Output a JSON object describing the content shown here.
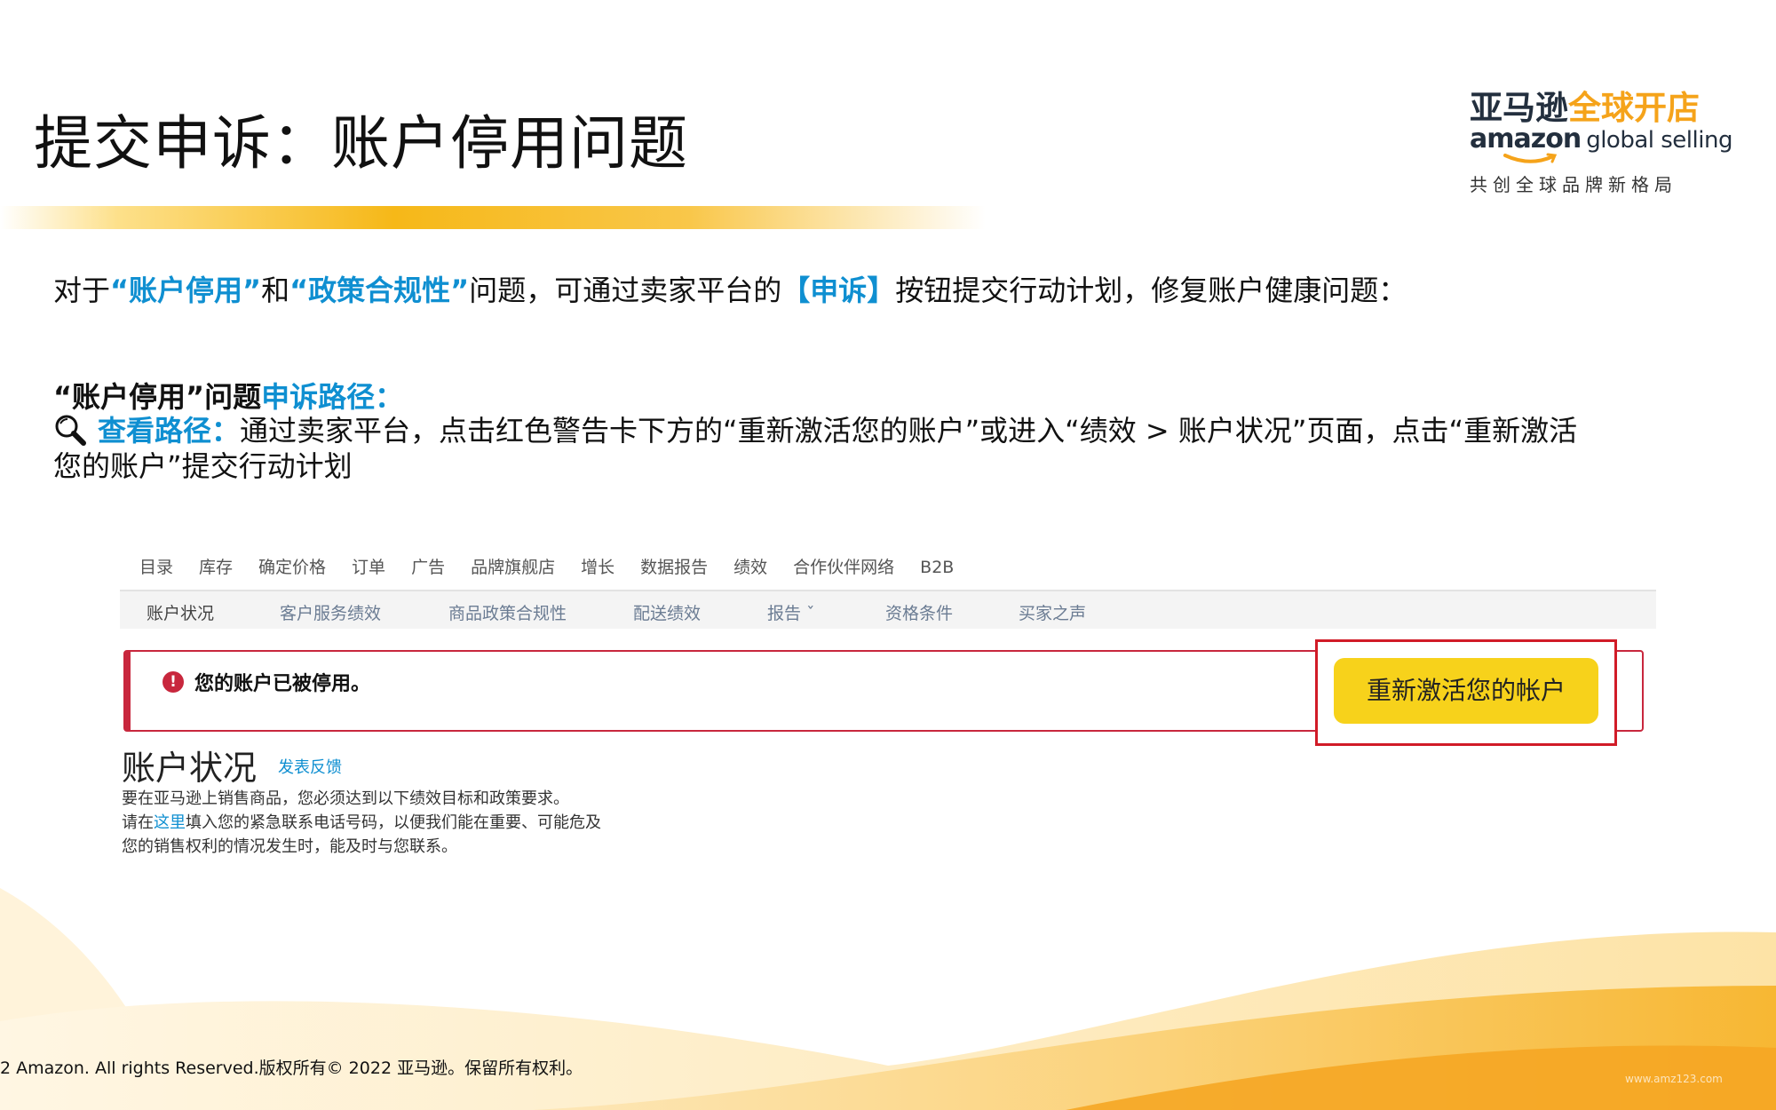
{
  "title": "提交申诉：账户停用问题",
  "logo": {
    "cn_part1": "亚马逊",
    "cn_part2": "全球开店",
    "en_brand": "amazon",
    "en_suffix": "global selling",
    "slogan": "共创全球品牌新格局"
  },
  "intro": {
    "p1": "对于",
    "hl1": "“账户停用”",
    "p2": "和",
    "hl2": "“政策合规性”",
    "p3": "问题，可通过卖家平台的",
    "hl3": "【申诉】",
    "p4": "按钮提交行动计划，修复账户健康问题："
  },
  "appeal_path": {
    "head_black": "“账户停用”问题",
    "head_blue": "申诉路径：",
    "view_label": "查看路径：",
    "view_text": "通过卖家平台，点击红色警告卡下方的“重新激活您的账户”或进入“绩效 > 账户状况”页面，点击“重新激活您的账户”提交行动计划",
    "icon": "magnifier-icon"
  },
  "screenshot": {
    "top_nav": [
      "目录",
      "库存",
      "确定价格",
      "订单",
      "广告",
      "品牌旗舰店",
      "增长",
      "数据报告",
      "绩效",
      "合作伙伴网络",
      "B2B"
    ],
    "sub_nav": [
      "账户状况",
      "客户服务绩效",
      "商品政策合规性",
      "配送绩效",
      "报告 ˇ",
      "资格条件",
      "买家之声"
    ],
    "alert_icon": "!",
    "alert_text": "您的账户已被停用。",
    "reactivate_button": "重新激活您的帐户",
    "account_title": "账户状况",
    "feedback_link": "发表反馈",
    "desc_line1": "要在亚马逊上销售商品，您必须达到以下绩效目标和政策要求。",
    "desc_line2_a": "请在",
    "desc_line2_link": "这里",
    "desc_line2_b": "填入您的紧急联系电话号码，以便我们能在重要、可能危及您的销售权利的情况发生时，能及时与您联系。"
  },
  "footer": "2 Amazon. All rights Reserved.版权所有© 2022 亚马逊。保留所有权利。",
  "watermark": "www.amz123.com",
  "colors": {
    "accent_blue": "#0f8fd1",
    "brand_orange": "#f5a31a",
    "alert_red": "#c8273d",
    "button_yellow": "#f7d21b"
  }
}
